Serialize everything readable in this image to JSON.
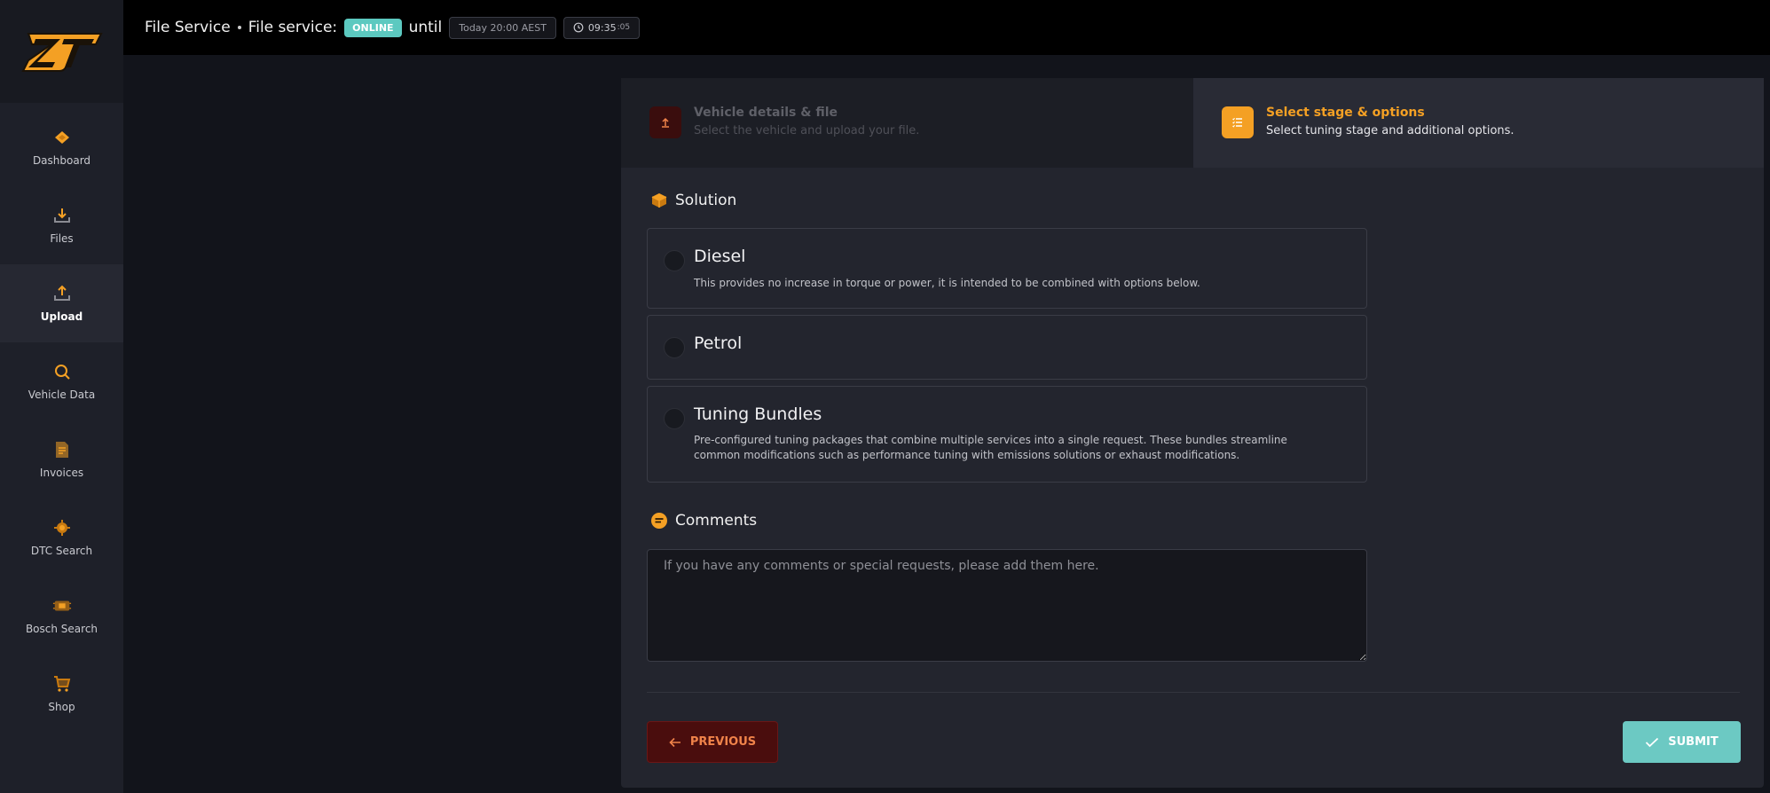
{
  "brand": {
    "logo_text": "ZT",
    "accent": "#f4a024"
  },
  "sidebar": {
    "items": [
      {
        "label": "Dashboard",
        "icon": "diamond-icon",
        "active": false
      },
      {
        "label": "Files",
        "icon": "download-tray-icon",
        "active": false
      },
      {
        "label": "Upload",
        "icon": "upload-tray-icon",
        "active": true
      },
      {
        "label": "Vehicle Data",
        "icon": "search-icon",
        "active": false
      },
      {
        "label": "Invoices",
        "icon": "document-icon",
        "active": false
      },
      {
        "label": "DTC Search",
        "icon": "engine-icon",
        "active": false
      },
      {
        "label": "Bosch Search",
        "icon": "chip-icon",
        "active": false
      },
      {
        "label": "Shop",
        "icon": "cart-icon",
        "active": false
      }
    ]
  },
  "header": {
    "title": "File Service",
    "service_label": "File service:",
    "status": "ONLINE",
    "until_label": "until",
    "until_time": "Today 20:00 AEST",
    "clock": "09:35",
    "clock_seconds": ":05",
    "status_color": "#5cc9c0"
  },
  "steps": [
    {
      "title": "Vehicle details & file",
      "subtitle": "Select the vehicle and upload your file.",
      "icon": "upload-icon",
      "active": false
    },
    {
      "title": "Select stage & options",
      "subtitle": "Select tuning stage and additional options.",
      "icon": "list-icon",
      "active": true
    }
  ],
  "solution": {
    "heading": "Solution",
    "options": [
      {
        "title": "Diesel",
        "description": "This provides no increase in torque or power, it is intended to be combined with options below."
      },
      {
        "title": "Petrol",
        "description": ""
      },
      {
        "title": "Tuning Bundles",
        "description": "Pre-configured tuning packages that combine multiple services into a single request. These bundles streamline common modifications such as performance tuning with emissions solutions or exhaust modifications."
      }
    ]
  },
  "comments": {
    "heading": "Comments",
    "placeholder": "If you have any comments or special requests, please add them here.",
    "value": ""
  },
  "buttons": {
    "previous": "PREVIOUS",
    "submit": "SUBMIT"
  }
}
